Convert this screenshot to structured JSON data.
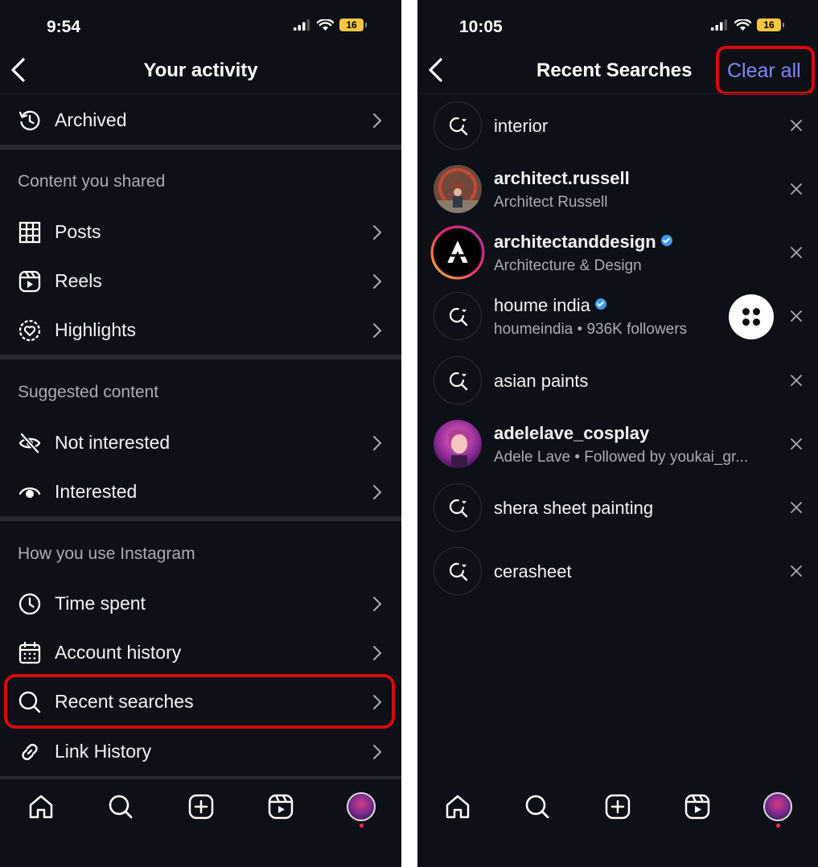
{
  "left": {
    "status": {
      "time": "9:54",
      "battery": "16"
    },
    "header": {
      "title": "Your activity"
    },
    "archived": "Archived",
    "sections": {
      "content_shared": "Content you shared",
      "suggested": "Suggested content",
      "how_you_use": "How you use Instagram"
    },
    "items": {
      "posts": "Posts",
      "reels": "Reels",
      "highlights": "Highlights",
      "not_interested": "Not interested",
      "interested": "Interested",
      "time_spent": "Time spent",
      "account_history": "Account history",
      "recent_searches": "Recent searches",
      "link_history": "Link History"
    }
  },
  "right": {
    "status": {
      "time": "10:05",
      "battery": "16"
    },
    "header": {
      "title": "Recent Searches",
      "clear_all": "Clear all"
    },
    "searches": [
      {
        "title": "interior",
        "type": "query"
      },
      {
        "title": "architect.russell",
        "subtitle": "Architect Russell",
        "type": "account"
      },
      {
        "title": "architectanddesign",
        "subtitle": "Architecture & Design",
        "type": "account",
        "verified": true
      },
      {
        "title": "houme india",
        "subtitle": "houmeindia • 936K followers",
        "type": "query",
        "verified": true
      },
      {
        "title": "asian paints",
        "type": "query"
      },
      {
        "title": "adelelave_cosplay",
        "subtitle": "Adele Lave • Followed by youkai_gr...",
        "type": "account"
      },
      {
        "title": "shera sheet painting",
        "type": "query"
      },
      {
        "title": "cerasheet",
        "type": "query"
      }
    ]
  },
  "icons": [
    "back-chevron-icon",
    "history-icon",
    "grid-icon",
    "reels-icon",
    "highlights-icon",
    "eye-slash-icon",
    "eye-icon",
    "clock-icon",
    "calendar-icon",
    "search-icon",
    "link-icon",
    "chevron-right-icon",
    "close-icon",
    "home-icon",
    "add-icon",
    "verified-icon"
  ],
  "colors": {
    "background": "#0d1016",
    "text": "#f2f3f5",
    "secondary_text": "#a8adb5",
    "accent": "#7f87f8",
    "highlight": "#d8090f",
    "verified": "#3b9cf0"
  }
}
